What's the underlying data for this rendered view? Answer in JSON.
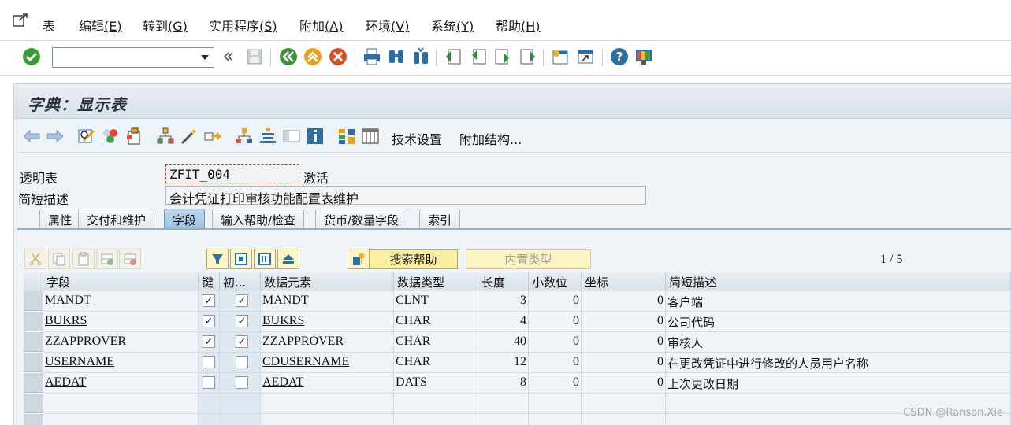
{
  "menubar": {
    "items": [
      {
        "label": "表",
        "shortcut": ""
      },
      {
        "label": "编辑",
        "shortcut": "(E)"
      },
      {
        "label": "转到",
        "shortcut": "(G)"
      },
      {
        "label": "实用程序",
        "shortcut": "(S)"
      },
      {
        "label": "附加",
        "shortcut": "(A)"
      },
      {
        "label": "环境",
        "shortcut": "(V)"
      },
      {
        "label": "系统",
        "shortcut": "(Y)"
      },
      {
        "label": "帮助",
        "shortcut": "(H)"
      }
    ]
  },
  "toolbar": {
    "command_value": "",
    "icons": [
      "enter-icon",
      "back-double-arrow-icon",
      "save-icon",
      "back-icon",
      "exit-icon",
      "cancel-icon",
      "print-icon",
      "find-icon",
      "find-next-icon",
      "first-page-icon",
      "prev-page-icon",
      "next-page-icon",
      "last-page-icon",
      "new-session-icon",
      "shortcut-icon",
      "help-icon",
      "customize-layout-icon"
    ]
  },
  "screen": {
    "title": "字典：显示表",
    "app_toolbar": {
      "tech_settings": "技术设置",
      "append_structure": "附加结构..."
    },
    "transparent_table_label": "透明表",
    "table_name": "ZFIT_004",
    "status": "激活",
    "short_desc_label": "简短描述",
    "short_desc": "会计凭证打印审核功能配置表维护"
  },
  "tabs": [
    {
      "label": "属性",
      "active": false
    },
    {
      "label": "交付和维护",
      "active": false
    },
    {
      "label": "字段",
      "active": true
    },
    {
      "label": "输入帮助/检查",
      "active": false
    },
    {
      "label": "货币/数量字段",
      "active": false
    },
    {
      "label": "索引",
      "active": false
    }
  ],
  "fields_tab": {
    "search_help_button": "搜索帮助",
    "builtin_type_button": "内置类型",
    "pager": "1 / 5",
    "columns": [
      "字段",
      "键",
      "初...",
      "数据元素",
      "数据类型",
      "长度",
      "小数位",
      "坐标",
      "简短描述"
    ],
    "rows": [
      {
        "field": "MANDT",
        "key": true,
        "init": true,
        "element": "MANDT",
        "type": "CLNT",
        "length": "3",
        "decimals": "0",
        "coord": "0",
        "desc": "客户端"
      },
      {
        "field": "BUKRS",
        "key": true,
        "init": true,
        "element": "BUKRS",
        "type": "CHAR",
        "length": "4",
        "decimals": "0",
        "coord": "0",
        "desc": "公司代码"
      },
      {
        "field": "ZZAPPROVER",
        "key": true,
        "init": true,
        "element": "ZZAPPROVER",
        "type": "CHAR",
        "length": "40",
        "decimals": "0",
        "coord": "0",
        "desc": "审核人"
      },
      {
        "field": "USERNAME",
        "key": false,
        "init": false,
        "element": "CDUSERNAME",
        "type": "CHAR",
        "length": "12",
        "decimals": "0",
        "coord": "0",
        "desc": "在更改凭证中进行修改的人员用户名称"
      },
      {
        "field": "AEDAT",
        "key": false,
        "init": false,
        "element": "AEDAT",
        "type": "DATS",
        "length": "8",
        "decimals": "0",
        "coord": "0",
        "desc": "上次更改日期"
      }
    ]
  },
  "watermark": "CSDN @Ranson.Xie"
}
